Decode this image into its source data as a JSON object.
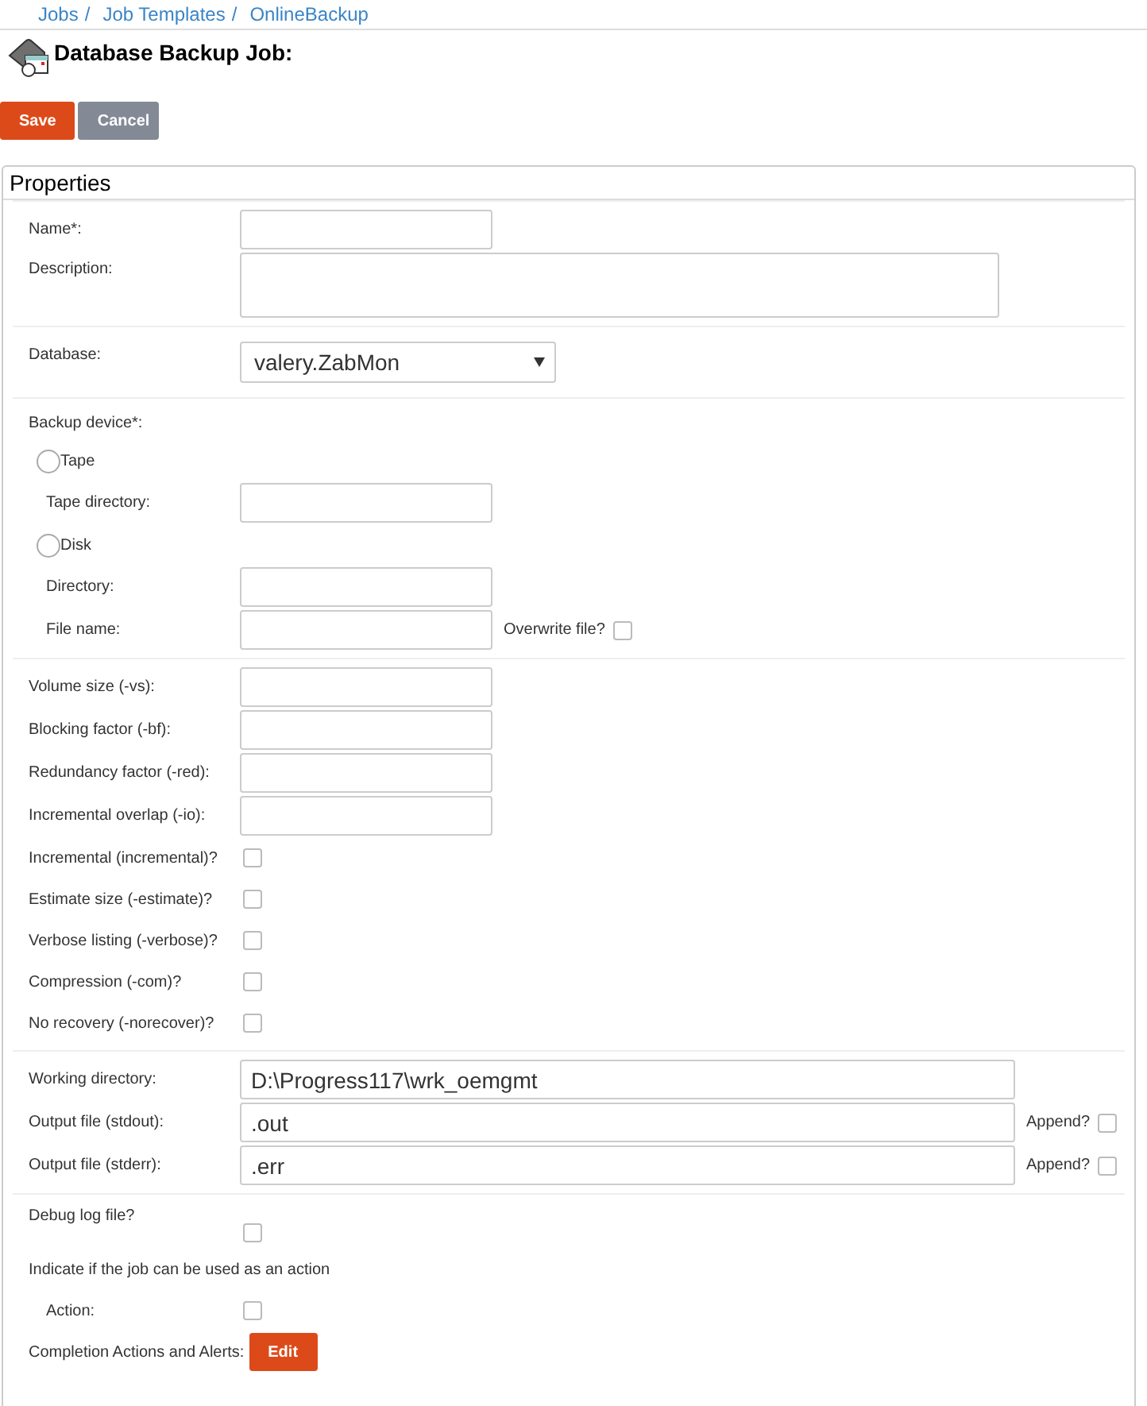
{
  "breadcrumb": [
    {
      "label": "Jobs",
      "separator": "/"
    },
    {
      "label": "Job Templates",
      "separator": "/"
    },
    {
      "label": "OnlineBackup"
    }
  ],
  "title": "Database Backup Job:",
  "buttons": [
    {
      "label": "Save",
      "kind": "primary"
    },
    {
      "label": "Cancel",
      "kind": "secondary"
    }
  ],
  "panel": {
    "title": "Properties",
    "sections": [
      {
        "rows": [
          {
            "kind": "text",
            "label": "Name*:"
          },
          {
            "kind": "textarea",
            "label": "Description:"
          }
        ]
      },
      {
        "rows": [
          {
            "kind": "select",
            "label": "Database:",
            "value": "valery.ZabMon"
          }
        ]
      },
      {
        "rows": [
          {
            "kind": "heading",
            "label": "Backup device*:"
          },
          {
            "kind": "radio",
            "label": "Tape",
            "selected": false
          },
          {
            "kind": "text",
            "label": "Tape directory:",
            "indented": true
          },
          {
            "kind": "radio",
            "label": "Disk",
            "selected": false
          },
          {
            "kind": "text",
            "label": "Directory:",
            "indented": true
          },
          {
            "kind": "text",
            "label": "File name:",
            "indented": true,
            "extra": {
              "label": "Overwrite file?",
              "checked": false
            }
          }
        ]
      },
      {
        "rows": [
          {
            "kind": "text",
            "label": "Volume size (-vs):"
          },
          {
            "kind": "text",
            "label": "Blocking factor (-bf):"
          },
          {
            "kind": "text",
            "label": "Redundancy factor (-red):"
          },
          {
            "kind": "text",
            "label": "Incremental overlap (-io):"
          },
          {
            "kind": "checkbox",
            "label": "Incremental (incremental)?",
            "checked": false
          },
          {
            "kind": "checkbox",
            "label": "Estimate size (-estimate)?",
            "checked": false
          },
          {
            "kind": "checkbox",
            "label": "Verbose listing (-verbose)?",
            "checked": false
          },
          {
            "kind": "checkbox",
            "label": "Compression (-com)?",
            "checked": false
          },
          {
            "kind": "checkbox",
            "label": "No recovery (-norecover)?",
            "checked": false
          }
        ]
      },
      {
        "rows": [
          {
            "kind": "wide",
            "label": "Working directory:",
            "value": "D:\\Progress117\\wrk_oemgmt"
          },
          {
            "kind": "wide",
            "label": "Output file (stdout):",
            "value": ".out",
            "extra": {
              "label": "Append?",
              "checked": false
            }
          },
          {
            "kind": "wide",
            "label": "Output file (stderr):",
            "value": ".err",
            "extra": {
              "label": "Append?",
              "checked": false
            }
          }
        ]
      },
      {
        "rows": [
          {
            "kind": "checkbox-low",
            "label": "Debug log file?",
            "checked": false
          },
          {
            "kind": "note",
            "label": "Indicate if the job can be used as an action"
          },
          {
            "kind": "checkbox",
            "label": "Action:",
            "checked": false,
            "indented": true
          },
          {
            "kind": "button",
            "label": "Completion Actions and Alerts:",
            "button": "Edit"
          }
        ]
      }
    ]
  }
}
